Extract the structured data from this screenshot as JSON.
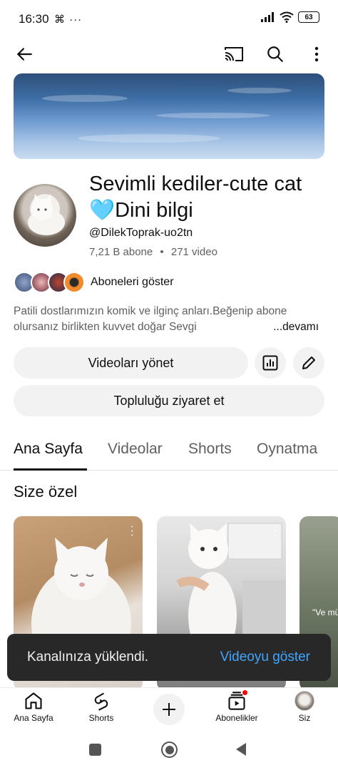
{
  "status_bar": {
    "time": "16:30",
    "left_icons": "⌘ ···",
    "battery": "63"
  },
  "channel": {
    "name": "Sevimli kediler-cute cat🩵Dini bilgi",
    "handle": "@DilekToprak-uo2tn",
    "subscribers": "7,21 B abone",
    "separator": "•",
    "videos": "271 video",
    "subscribers_link": "Aboneleri göster",
    "description": "Patili dostlarımızın komik ve ilginç anları.Beğenip abone olursanız birlikten kuvvet doğar Sevgi",
    "description_more": "...devamı"
  },
  "buttons": {
    "manage_videos": "Videoları yönet",
    "visit_community": "Topluluğu ziyaret et"
  },
  "tabs": [
    {
      "label": "Ana Sayfa",
      "active": true
    },
    {
      "label": "Videolar",
      "active": false
    },
    {
      "label": "Shorts",
      "active": false
    },
    {
      "label": "Oynatma",
      "active": false
    }
  ],
  "section": {
    "title": "Size özel"
  },
  "cards": [
    {
      "caption": ""
    },
    {
      "caption": ""
    },
    {
      "caption": "\"Ve mü"
    }
  ],
  "snackbar": {
    "message": "Kanalınıza yüklendi.",
    "action": "Videoyu göster"
  },
  "bottom_nav": [
    {
      "label": "Ana Sayfa",
      "icon": "home-icon"
    },
    {
      "label": "Shorts",
      "icon": "shorts-icon"
    },
    {
      "label": "",
      "icon": "create-icon"
    },
    {
      "label": "Abonelikler",
      "icon": "subscriptions-icon"
    },
    {
      "label": "Siz",
      "icon": "profile-avatar"
    }
  ],
  "colors": {
    "accent_link": "#3ea6ff",
    "pill_bg": "#f2f2f2",
    "snackbar_bg": "#282828",
    "notification_dot": "#ff0000"
  }
}
